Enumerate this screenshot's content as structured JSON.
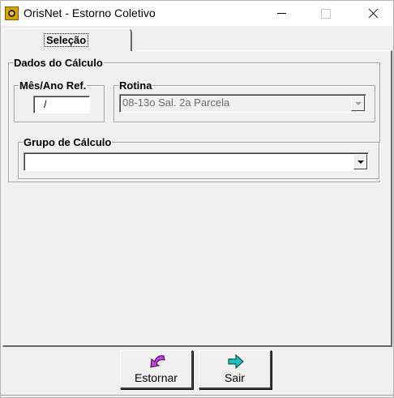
{
  "window": {
    "title": "OrisNet - Estorno Coletivo"
  },
  "tabs": [
    {
      "label": "Seleção",
      "active": true
    }
  ],
  "dados_calculo": {
    "label": "Dados do Cálculo",
    "mes_ano": {
      "label": "Mês/Ano Ref.",
      "value": "/"
    },
    "rotina": {
      "label": "Rotina",
      "value": "08-13o Sal. 2a Parcela",
      "enabled": false
    }
  },
  "grupo_calculo": {
    "label": "Grupo de Cálculo",
    "value": ""
  },
  "buttons": {
    "estornar": {
      "label": "Estornar",
      "icon": "undo-arrow-icon",
      "color": "#c040e0"
    },
    "sair": {
      "label": "Sair",
      "icon": "exit-arrow-icon",
      "color": "#20c0c0"
    }
  },
  "colors": {
    "window_bg": "#f0f0f0",
    "app_icon": "#d9a400"
  }
}
